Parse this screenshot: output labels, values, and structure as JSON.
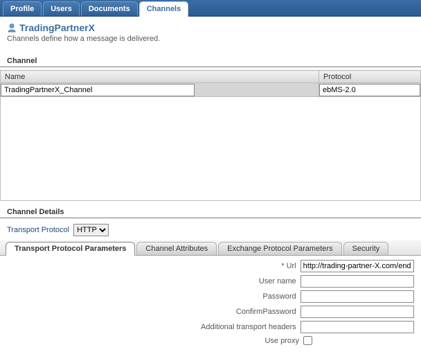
{
  "topTabs": {
    "profile": "Profile",
    "users": "Users",
    "documents": "Documents",
    "channels": "Channels"
  },
  "page": {
    "title": "TradingPartnerX",
    "desc": "Channels define how a message is delivered."
  },
  "sections": {
    "channel": "Channel",
    "channelDetails": "Channel Details"
  },
  "table": {
    "headers": {
      "name": "Name",
      "protocol": "Protocol"
    },
    "row": {
      "name": "TradingPartnerX_Channel",
      "protocol": "ebMS-2.0"
    }
  },
  "transportProtocol": {
    "label": "Transport Protocol",
    "options": [
      "HTTP"
    ],
    "selected": "HTTP"
  },
  "detailTabs": {
    "tpp": "Transport Protocol Parameters",
    "ca": "Channel Attributes",
    "epp": "Exchange Protocol Parameters",
    "sec": "Security"
  },
  "form": {
    "url": {
      "label": "Url",
      "value": "http://trading-partner-X.com/endpoint"
    },
    "username": {
      "label": "User name",
      "value": ""
    },
    "password": {
      "label": "Password",
      "value": ""
    },
    "confirmPassword": {
      "label": "ConfirmPassword",
      "value": ""
    },
    "additionalHeaders": {
      "label": "Additional transport headers",
      "value": ""
    },
    "useProxy": {
      "label": "Use proxy",
      "checked": false
    }
  }
}
